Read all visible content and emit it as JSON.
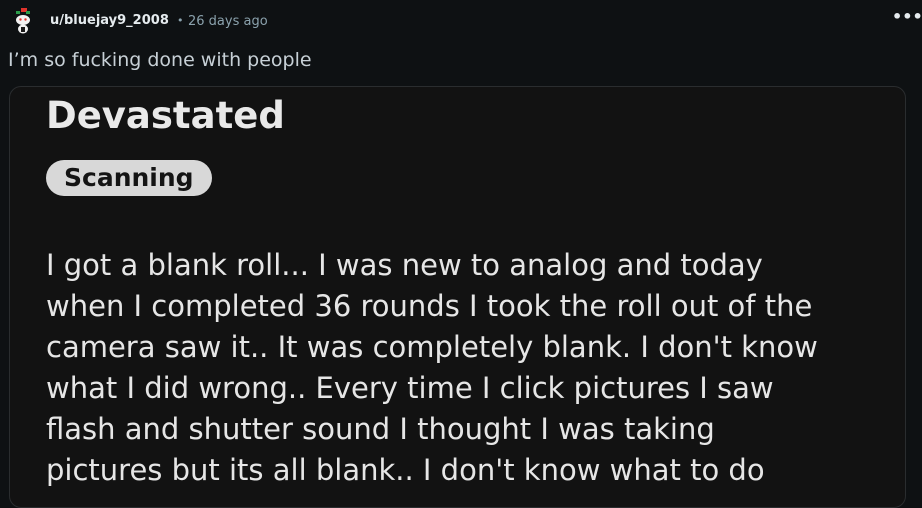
{
  "header": {
    "username": "u/bluejay9_2008",
    "separator": "•",
    "time": "26 days ago",
    "more_icon": "more-horizontal-icon"
  },
  "post": {
    "title": "I’m so fucking done with people"
  },
  "card": {
    "title": "Devastated",
    "tag": "Scanning",
    "body_lines": [
      "I got a blank roll... I was new to analog and today",
      "when I completed 36 rounds I took the roll out of the",
      "camera saw it.. It was completely blank. I don't know",
      "what I did wrong.. Every time I click pictures I saw",
      "flash and shutter sound I thought I was taking",
      "pictures but its all blank.. I don't know what to do"
    ]
  }
}
